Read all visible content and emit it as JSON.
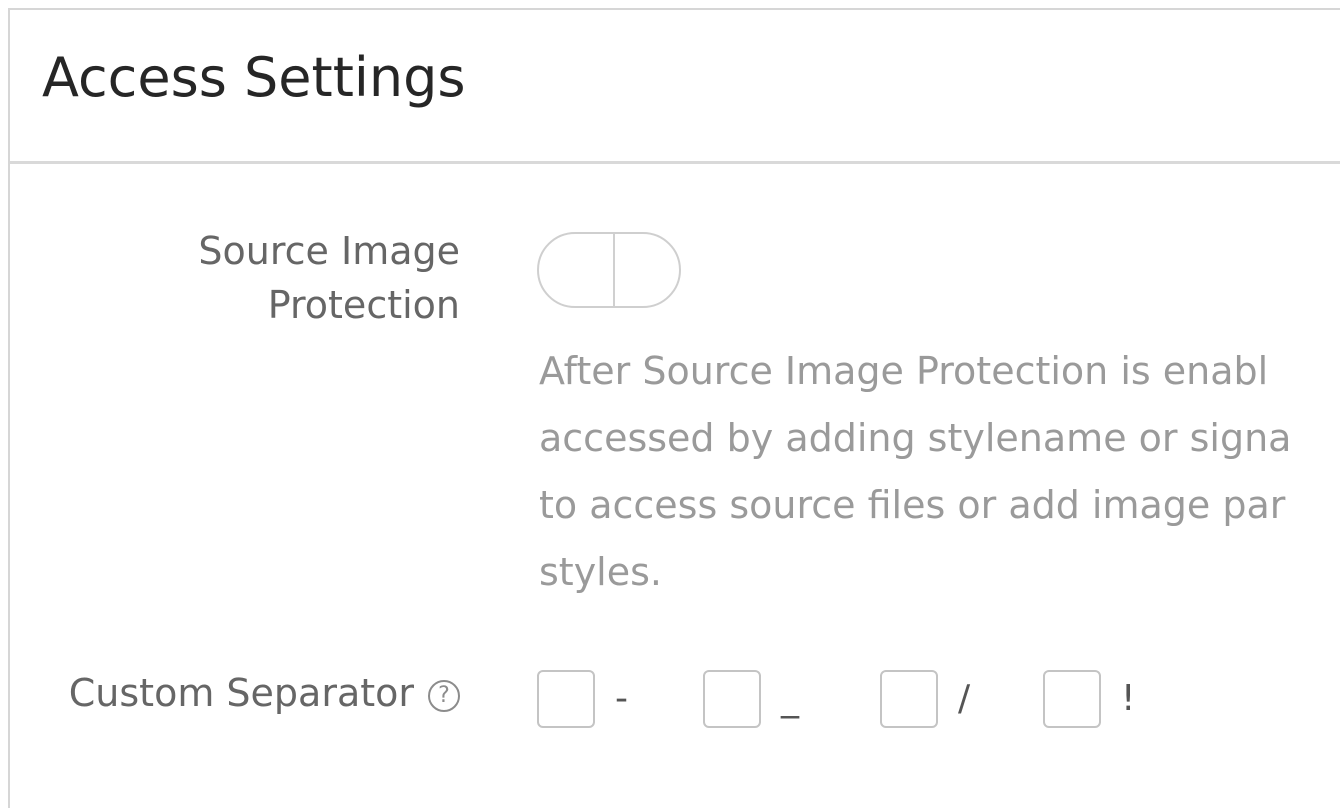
{
  "header": {
    "title": "Access Settings"
  },
  "source_image_protection": {
    "label_line1": "Source Image",
    "label_line2": "Protection",
    "toggle_state": "off",
    "description_lines": [
      "After Source Image Protection is enabl",
      "accessed by adding stylename or signa",
      "to access source files or add image par",
      "styles."
    ]
  },
  "custom_separator": {
    "label": "Custom Separator",
    "help_icon": "question-circle-icon",
    "options": [
      {
        "label": "-",
        "checked": false
      },
      {
        "label": "_",
        "checked": false
      },
      {
        "label": "/",
        "checked": false
      },
      {
        "label": "!",
        "checked": false
      }
    ]
  },
  "colors": {
    "title": "#262626",
    "label": "#666666",
    "description": "#9a9a9a",
    "border": "#d6d6d6"
  }
}
